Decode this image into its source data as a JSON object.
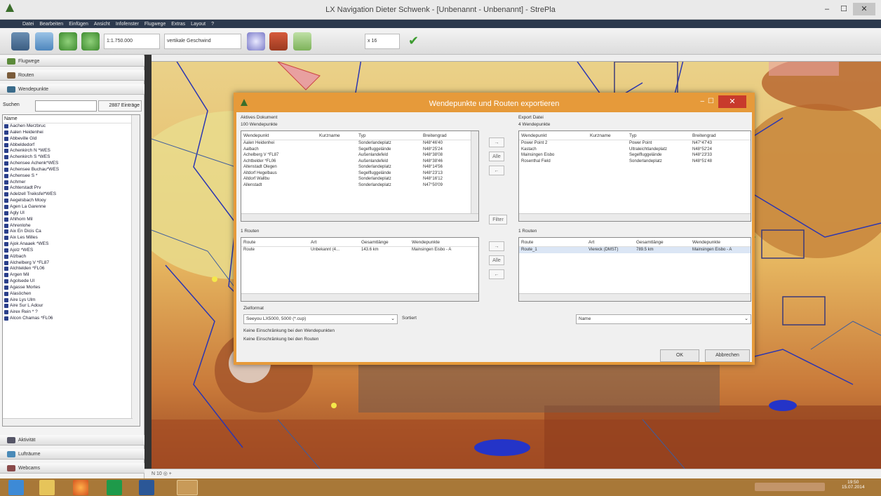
{
  "window": {
    "title": "LX Navigation Dieter Schwenk - [Unbenannt - Unbenannt] - StrePla",
    "min": "–",
    "max": "☐",
    "close": "✕"
  },
  "menu": [
    "Datei",
    "Bearbeiten",
    "Einfügen",
    "Ansicht",
    "Infofenster",
    "Flugwege",
    "Extras",
    "Layout",
    "?"
  ],
  "toolbar": {
    "scale": "1:1.750.000",
    "speed_select": "vertikale Geschwind",
    "zoom_select": "x 16"
  },
  "left_tabs": {
    "flugwege": "Flugwege",
    "routen": "Routen",
    "wendepunkte": "Wendepunkte",
    "aktivitaet": "Aktivität",
    "luftraeume": "Lufträume",
    "webcams": "Webcams"
  },
  "waypoints": {
    "search_label": "Suchen",
    "count": "2887 Einträge",
    "header": "Name",
    "rows": [
      "Aachen Merzbruc",
      "Aalen Heidenhei",
      "Abbeville Gld",
      "Abbeldedorf",
      "Achenkirch N *WES",
      "Achenkirch S *WES",
      "Achensee Achenk*WES",
      "Achensee Buchau*WES",
      "Achensee S *",
      "Achmer",
      "Achterstadt Prv",
      "Adelzell Treiksfel*WES",
      "Aegelsbach Mooy",
      "Agen La Garenne",
      "Agly UI",
      "Ahlhorn Mil",
      "Ahrenlohe",
      "Aix En Dicis Ca",
      "Aix Les Milles",
      "Ajok Anaaek *WES",
      "Ajolz *WES",
      "Alzbach",
      "Alchelberg V *FL87",
      "Alchtelden *FL06",
      "Argen Mil",
      "Agolsede Ul",
      "Agasse Mortes",
      "Alasöchen",
      "Aire Lys Ulm",
      "Aire Sur L Adour",
      "Airex Rein * ?",
      "Alcon Chamas *FL06"
    ]
  },
  "dialog": {
    "title": "Wendepunkte und Routen exportieren",
    "active_doc": "Aktives Dokument",
    "active_wp_count": "100 Wendepunkte",
    "export_file": "Export Datei",
    "export_wp_count": "4 Wendepunkte",
    "wp_cols": [
      "Wendepunkt",
      "Kurzname",
      "Typ",
      "Breitengrad"
    ],
    "left_wp_rows": [
      [
        "Aalen Heidenhei",
        "",
        "Sonderlandeplatz",
        "N48°46'40"
      ],
      [
        "Aalbach",
        "",
        "Segelfluggelände",
        "N48°25'24"
      ],
      [
        "Achelberg V *FL87",
        "",
        "Außenlandefeld",
        "N48°38'08"
      ],
      [
        "Achtbelder *FL06",
        "",
        "Außenlandefeld",
        "N48°38'46"
      ],
      [
        "Altenstadt Ölegen",
        "",
        "Sonderlandeplatz",
        "N48°14'56"
      ],
      [
        "Altdorf Hegelbaus",
        "",
        "Segelfluggelände",
        "N48°23'13"
      ],
      [
        "Altdorf Wallbu",
        "",
        "Sonderlandeplatz",
        "N48°16'12"
      ],
      [
        "Allenstadt",
        "",
        "Sonderlandeplatz",
        "N47°50'09"
      ]
    ],
    "right_wp_rows": [
      [
        "Power Point 2",
        "",
        "Power Point",
        "N47°47'43"
      ],
      [
        "Kastach",
        "",
        "Ultraleichtlandeplatz",
        "N48°52'24"
      ],
      [
        "Mainsingen Eisbo",
        "",
        "Segelfluggelände",
        "N48°23'33"
      ],
      [
        "Rosenthal Field",
        "",
        "Sonderlandeplatz",
        "N48°51'48"
      ]
    ],
    "btn_all": "Alle",
    "btn_filter": "Filter",
    "left_routes_count": "1 Routen",
    "right_routes_count": "1 Routen",
    "route_cols": [
      "Route",
      "Art",
      "Gesamtlänge",
      "Wendepunkte"
    ],
    "left_route_rows": [
      [
        "Route",
        "Unbekannt (4...",
        "143.6 km",
        "Mainsingen Eisbo - A"
      ]
    ],
    "right_route_rows": [
      [
        "Route_1",
        "Viereck (DMST)",
        "789.5 km",
        "Mainsingen Eisbo - A"
      ]
    ],
    "target_format_label": "Zielformat",
    "target_format": "Seeyou LX5000, 5000 (*.cup)",
    "sort_label": "Sortiert",
    "sort_value": "Name",
    "note1": "Keine Einschränkung bei den Wendepunkten",
    "note2": "Keine Einschränkung bei den Routen",
    "ok": "OK",
    "cancel": "Abbrechen",
    "arrow_right": "→",
    "arrow_left": "←"
  },
  "statusbar": "N 10 ◎ +",
  "taskbar": {
    "clock_time": "19:50",
    "clock_date": "15.07.2014"
  },
  "colors": {
    "dialog_accent": "#e69a3a",
    "taskbar": "#a87838",
    "close": "#c83a2c"
  }
}
